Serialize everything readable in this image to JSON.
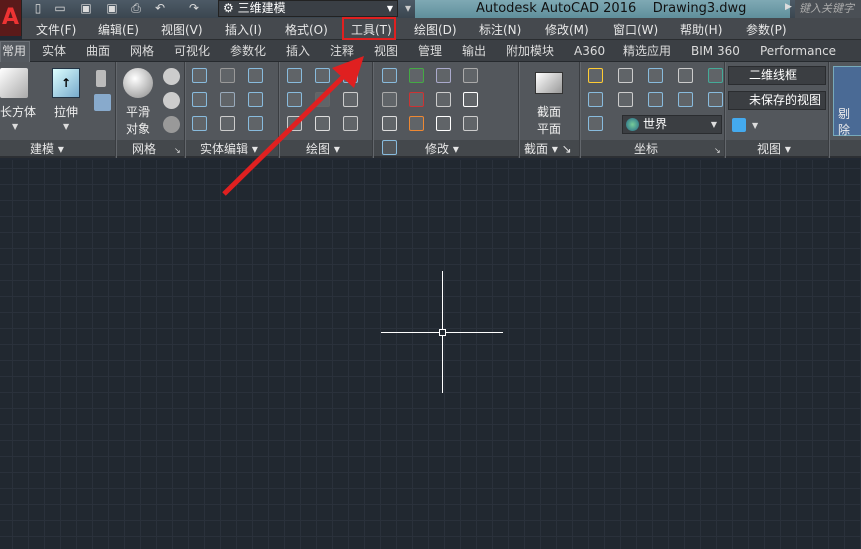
{
  "titlebar": {
    "workspace": "三维建模",
    "app_title": "Autodesk AutoCAD 2016",
    "file_name": "Drawing3.dwg",
    "search_placeholder": "键入关键字或短语",
    "quick_access": [
      "new-icon",
      "open-icon",
      "save-icon",
      "save-as-icon",
      "plot-icon",
      "undo-icon",
      "redo-icon"
    ]
  },
  "menubar": [
    "文件(F)",
    "编辑(E)",
    "视图(V)",
    "插入(I)",
    "格式(O)",
    "工具(T)",
    "绘图(D)",
    "标注(N)",
    "修改(M)",
    "窗口(W)",
    "帮助(H)",
    "参数(P)"
  ],
  "tabs": [
    "常用",
    "实体",
    "曲面",
    "网格",
    "可视化",
    "参数化",
    "插入",
    "注释",
    "视图",
    "管理",
    "输出",
    "附加模块",
    "A360",
    "精选应用",
    "BIM 360",
    "Performance"
  ],
  "panels": {
    "modeling": {
      "title": "建模",
      "box": "长方体",
      "extrude": "拉伸"
    },
    "mesh": {
      "title": "网格",
      "smooth_line1": "平滑",
      "smooth_line2": "对象"
    },
    "solid_edit": {
      "title": "实体编辑"
    },
    "draw": {
      "title": "绘图"
    },
    "modify": {
      "title": "修改"
    },
    "section": {
      "title": "截面",
      "plane_line1": "截面",
      "plane_line2": "平面"
    },
    "coordinates": {
      "title": "坐标",
      "ucs": "世界"
    },
    "view": {
      "title": "视图",
      "visual_style": "二维线框",
      "named_view": "未保存的视图"
    },
    "cull": {
      "label": "剔除"
    }
  },
  "colors": {
    "accent_red": "#e02020",
    "canvas": "#212830"
  }
}
